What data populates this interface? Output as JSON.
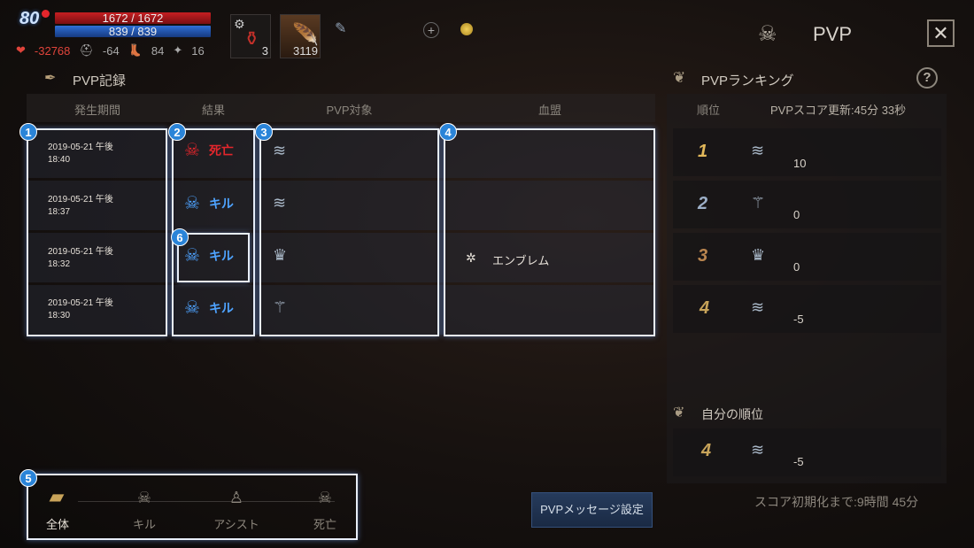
{
  "player": {
    "level": "80",
    "hp": "1672 / 1672",
    "mp": "839 / 839",
    "stat_attack": "-32768",
    "stat_def": "-64",
    "stat_3": "84",
    "stat_4": "16"
  },
  "quickslots": [
    {
      "icon": "potion-icon",
      "count": "3"
    },
    {
      "icon": "feather-icon",
      "count": "3119"
    }
  ],
  "header": {
    "title": "PVP",
    "close_icon": "close-icon"
  },
  "records": {
    "title": "PVP記録",
    "columns": [
      "発生期間",
      "結果",
      "PVP対象",
      "血盟"
    ],
    "rows": [
      {
        "date": "2019-05-21 午後",
        "time": "18:40",
        "result": "死亡",
        "type": "death",
        "clan": ""
      },
      {
        "date": "2019-05-21 午後",
        "time": "18:37",
        "result": "キル",
        "type": "kill",
        "clan": ""
      },
      {
        "date": "2019-05-21 午後",
        "time": "18:32",
        "result": "キル",
        "type": "kill",
        "clan": "エンブレム"
      },
      {
        "date": "2019-05-21 午後",
        "time": "18:30",
        "result": "キル",
        "type": "kill",
        "clan": ""
      }
    ]
  },
  "badges": [
    "1",
    "2",
    "3",
    "4",
    "5",
    "6"
  ],
  "ranking": {
    "title": "PVPランキング",
    "help": "?",
    "col_rank": "順位",
    "score_update": "PVPスコア更新:45分 33秒",
    "rows": [
      {
        "rank": "1",
        "score": "10"
      },
      {
        "rank": "2",
        "score": "0"
      },
      {
        "rank": "3",
        "score": "0"
      },
      {
        "rank": "4",
        "score": "-5"
      }
    ],
    "my_rank_title": "自分の順位",
    "my_rank": "4",
    "my_score": "-5"
  },
  "filters": [
    "全体",
    "キル",
    "アシスト",
    "死亡"
  ],
  "message_button": "PVPメッセージ設定",
  "reset_text": "スコア初期化まで:9時間 45分"
}
